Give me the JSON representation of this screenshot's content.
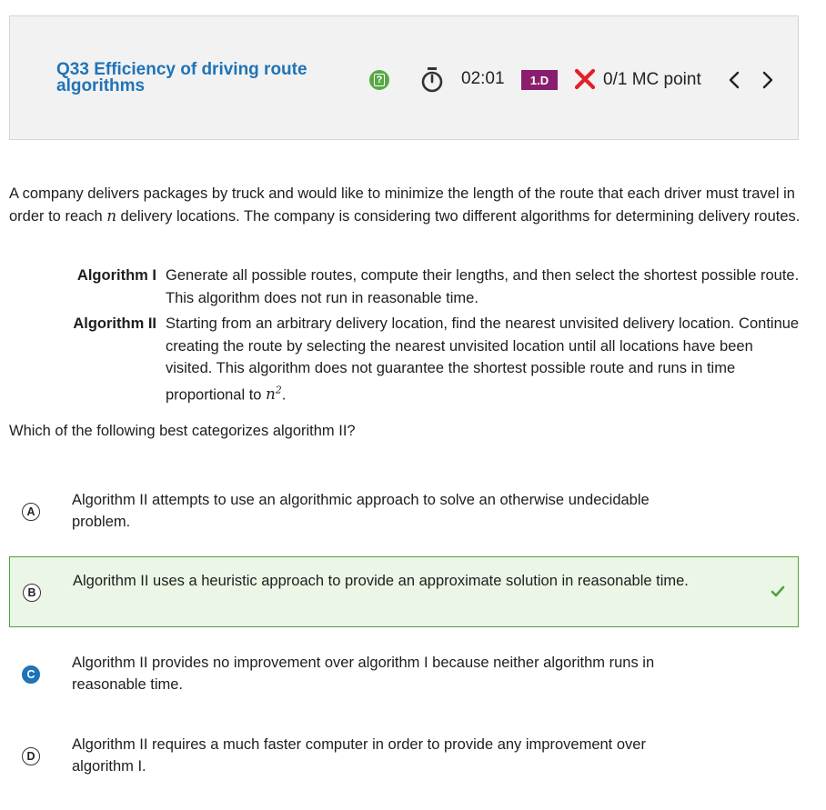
{
  "header": {
    "question_title": "Q33 Efficiency of driving route algorithms",
    "hint_icon_glyph": "?",
    "timer": "02:01",
    "skill_badge": "1.D",
    "score": "0/1 MC point",
    "colors": {
      "title": "#1f73b7",
      "badge": "#8a1e6e",
      "hint": "#56a845",
      "incorrect": "#e0202a"
    }
  },
  "stem": {
    "intro_before_n": "A company delivers packages by truck and would like to minimize the length of the route that each driver must travel in order to reach ",
    "n": "n",
    "intro_after_n": " delivery locations. The company is considering two different algorithms for determining delivery routes.",
    "algorithms": [
      {
        "label": "Algorithm I",
        "text": "Generate all possible routes, compute their lengths, and then select the shortest possible route. This algorithm does not run in reasonable time."
      },
      {
        "label": "Algorithm II",
        "text_before_math": "Starting from an arbitrary delivery location, find the nearest unvisited delivery location. Continue creating the route by selecting the nearest unvisited location until all locations have been visited. This algorithm does not guarantee the shortest possible route and runs in time proportional to ",
        "math_base": "n",
        "math_exp": "2",
        "text_after_math": "."
      }
    ],
    "prompt": "Which of the following best categorizes algorithm II?"
  },
  "choices": [
    {
      "letter": "A",
      "text": "Algorithm II attempts to use an algorithmic approach to solve an otherwise undecidable problem.",
      "state": "none"
    },
    {
      "letter": "B",
      "text": "Algorithm II uses a heuristic approach to provide an approximate solution in reasonable time.",
      "state": "correct"
    },
    {
      "letter": "C",
      "text": "Algorithm II provides no improvement over algorithm I because neither algorithm runs in reasonable time.",
      "state": "selected"
    },
    {
      "letter": "D",
      "text": "Algorithm II requires a much faster computer in order to provide any improvement over algorithm I.",
      "state": "none"
    }
  ]
}
